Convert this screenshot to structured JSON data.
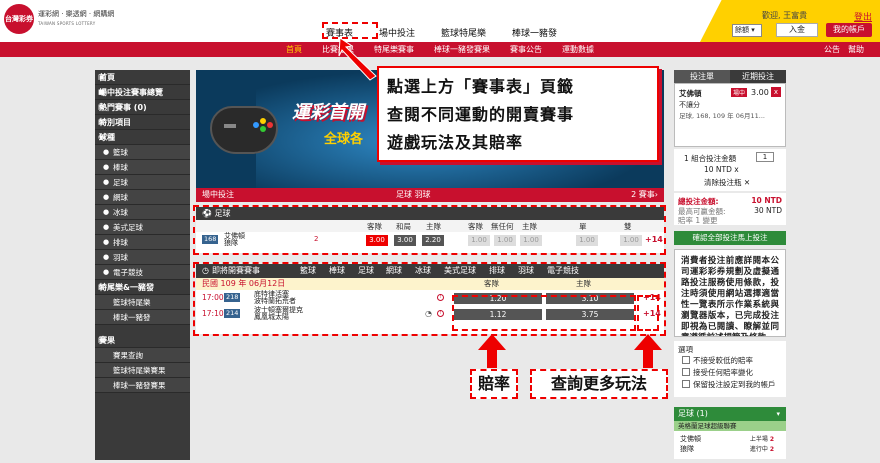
{
  "header": {
    "logo_text": "台灣彩券",
    "brand_zh": "運彩網 · 樂透網 · 網購網",
    "brand_en": "TAIWAN SPORTS LOTTERY",
    "nav": [
      "賽事表",
      "場中投注",
      "籃球特尾樂",
      "棒球一豬發"
    ],
    "welcome": "歡迎, 王富貴",
    "logout": "登出",
    "balance_label": "餘額",
    "deposit": "入金",
    "account": "我的帳戶"
  },
  "subnav": {
    "items": [
      "首頁",
      "比賽結果",
      "特尾樂賽事",
      "棒球一豬發賽果",
      "賽事公告",
      "運動數據"
    ],
    "right": [
      "公告",
      "幫助"
    ]
  },
  "sidebar": {
    "items": [
      {
        "label": "首頁",
        "icon": "home-icon",
        "glyph": "▣",
        "kind": "h"
      },
      {
        "label": "場中投注賽事總覽",
        "icon": "live-icon",
        "glyph": "■",
        "kind": "h"
      },
      {
        "label": "熱門賽事 (0)",
        "icon": "hot-icon",
        "glyph": "▤",
        "kind": "h"
      },
      {
        "label": "特別項目",
        "icon": "special-icon",
        "glyph": "▦",
        "kind": "h"
      },
      {
        "label": "球種",
        "icon": "ball-icon",
        "glyph": "◉",
        "kind": "h"
      },
      {
        "label": "籃球",
        "icon": "basketball-icon",
        "glyph": "●",
        "kind": "sub"
      },
      {
        "label": "棒球",
        "icon": "baseball-icon",
        "glyph": "●",
        "kind": "sub"
      },
      {
        "label": "足球",
        "icon": "soccer-icon",
        "glyph": "●",
        "kind": "sub"
      },
      {
        "label": "網球",
        "icon": "tennis-icon",
        "glyph": "●",
        "kind": "sub"
      },
      {
        "label": "冰球",
        "icon": "icehockey-icon",
        "glyph": "●",
        "kind": "sub"
      },
      {
        "label": "美式足球",
        "icon": "football-icon",
        "glyph": "●",
        "kind": "sub"
      },
      {
        "label": "排球",
        "icon": "volleyball-icon",
        "glyph": "●",
        "kind": "sub"
      },
      {
        "label": "羽球",
        "icon": "badminton-icon",
        "glyph": "●",
        "kind": "sub"
      },
      {
        "label": "電子競技",
        "icon": "esports-icon",
        "glyph": "●",
        "kind": "sub"
      },
      {
        "label": "特尾樂&一豬發",
        "icon": "special-game-icon",
        "glyph": "▦",
        "kind": "h"
      },
      {
        "label": "籃球特尾樂",
        "icon": "",
        "glyph": "",
        "kind": "sub"
      },
      {
        "label": "棒球一豬發",
        "icon": "",
        "glyph": "",
        "kind": "sub"
      },
      {
        "label": "",
        "icon": "",
        "glyph": "",
        "kind": "gap"
      },
      {
        "label": "賽果",
        "icon": "result-icon",
        "glyph": "▤",
        "kind": "h"
      },
      {
        "label": "賽果查詢",
        "icon": "",
        "glyph": "",
        "kind": "sub"
      },
      {
        "label": "籃球特尾樂賽果",
        "icon": "",
        "glyph": "",
        "kind": "sub"
      },
      {
        "label": "棒球一豬發賽果",
        "icon": "",
        "glyph": "",
        "kind": "sub"
      }
    ]
  },
  "banner": {
    "title": "運彩首開",
    "subtitle": "全球各",
    "strip_left": "場中投注",
    "strip_center": "足球  羽球",
    "strip_right": "2 賽事›"
  },
  "soccer_panel": {
    "title": "足球",
    "headers": [
      "客隊",
      "和局",
      "主隊",
      "客隊",
      "無任何",
      "主隊",
      "單",
      "雙"
    ],
    "game_id": "168",
    "team_away": "艾佛頓",
    "team_home": "狼隊",
    "score_note": "2",
    "odds": [
      "3.00",
      "3.00",
      "2.20",
      "1.00",
      "1.00",
      "1.00",
      "1.00",
      "1.00"
    ],
    "more": "+14"
  },
  "live_panel": {
    "title": "即將開賽賽事",
    "sports": [
      "籃球",
      "棒球",
      "足球",
      "網球",
      "冰球",
      "美式足球",
      "排球",
      "羽球",
      "電子競技"
    ],
    "date": "民國 109 年 06月12日",
    "col_away": "客隊",
    "col_home": "主隊",
    "matches": [
      {
        "time": "17:00",
        "id": "218",
        "away": "底特律活塞",
        "home": "波特蘭拓荒者",
        "odd_away": "1.20",
        "odd_home": "3.10",
        "more": "+14"
      },
      {
        "time": "17:10",
        "id": "214",
        "away": "波士頓塞爾提克",
        "home": "鳳凰城太陽",
        "odd_away": "1.12",
        "odd_home": "3.75",
        "more": "+14"
      }
    ]
  },
  "right_panel": {
    "tab_slip": "投注單",
    "tab_recent": "近期投注",
    "slip_team": "艾佛頓",
    "slip_kind": "不讓分",
    "slip_info": "足球, 168, 109 年 06月11...",
    "slip_tag": "場中",
    "slip_value": "3.00",
    "slip_close": "x",
    "combo_label": "1 組合投注金額",
    "combo_qty": "1",
    "combo_amount": "10 NTD x",
    "combo_clear": "清除投注瓶",
    "total_label": "總投注金額:",
    "total_value": "10 NTD",
    "max_label": "最高可贏金額:",
    "max_value": "30 NTD",
    "max_note": "賠率 1 變更",
    "confirm": "確認全部投注馬上投注",
    "notice": "消費者投注前應詳閱本公司運彩彩券規劃及虛擬通路投注服務使用條款，投注時須使用網站選擇適當性一覽表所示作業系統與瀏覽器版本，已完成投注即視為已閱讀、瞭解並同意遵循前述規範及條款。",
    "options_title": "選項",
    "options": [
      "不接受較低的賠率",
      "接受任何賠率變化",
      "保留投注設定到我的帳戶"
    ]
  },
  "soccer_box": {
    "title": "足球 (1)",
    "chevron": "▾",
    "league": "英格蘭足球超級聯賽",
    "team1": "艾佛頓",
    "team2": "狼隊",
    "half1": "上半場",
    "half2": "進行中",
    "score1": "2",
    "score2": "2"
  },
  "annotation": {
    "callout_line1": "點選上方「賽事表」頁籤",
    "callout_line2": "查閱不同運動的開賣賽事",
    "callout_line3": "遊戲玩法及其賠率",
    "label_odds": "賠率",
    "label_more": "查詢更多玩法"
  }
}
